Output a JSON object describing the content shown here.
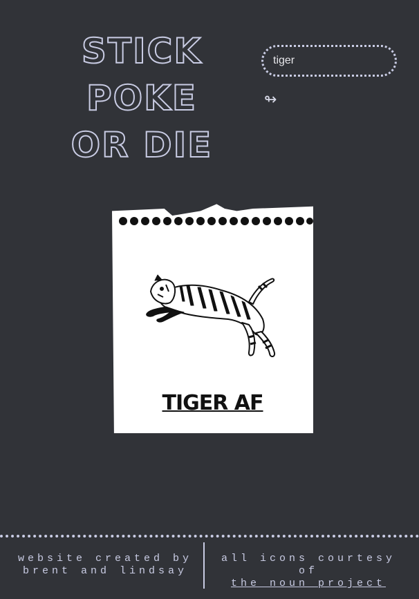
{
  "header": {
    "title_line1": "STICK POKE",
    "title_line2": "OR DIE"
  },
  "search": {
    "value": "tiger",
    "icon": "shuffle-arrows-icon"
  },
  "card": {
    "caption": "TIGER AF",
    "image": "tiger-leaping-icon"
  },
  "footer": {
    "left_line1": "website created by",
    "left_line2": "brent and lindsay",
    "right_line1": "all icons courtesy of",
    "right_link": "the noun project"
  },
  "colors": {
    "background": "#313338",
    "accent": "#c9cce4",
    "card": "#ffffff"
  }
}
